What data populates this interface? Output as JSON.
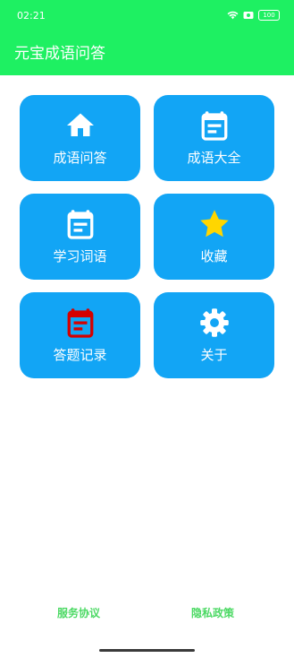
{
  "status_bar": {
    "time": "02:21",
    "battery": "100",
    "icons": [
      "wifi-icon",
      "screen-record-icon",
      "battery-icon"
    ]
  },
  "app_bar": {
    "title": "元宝成语问答"
  },
  "menu": [
    {
      "label": "成语问答",
      "icon": "home-icon"
    },
    {
      "label": "成语大全",
      "icon": "calendar-icon"
    },
    {
      "label": "学习词语",
      "icon": "calendar-icon"
    },
    {
      "label": "收藏",
      "icon": "star-icon"
    },
    {
      "label": "答题记录",
      "icon": "calendar-icon"
    },
    {
      "label": "关于",
      "icon": "gear-icon"
    }
  ],
  "footer": {
    "service_agreement": "服务协议",
    "privacy_policy": "隐私政策"
  },
  "colors": {
    "header": "#1ef062",
    "tile": "#12a5f5",
    "footer_link": "#4cd964",
    "star": "#ffd600",
    "record_icon": "#d50000"
  }
}
